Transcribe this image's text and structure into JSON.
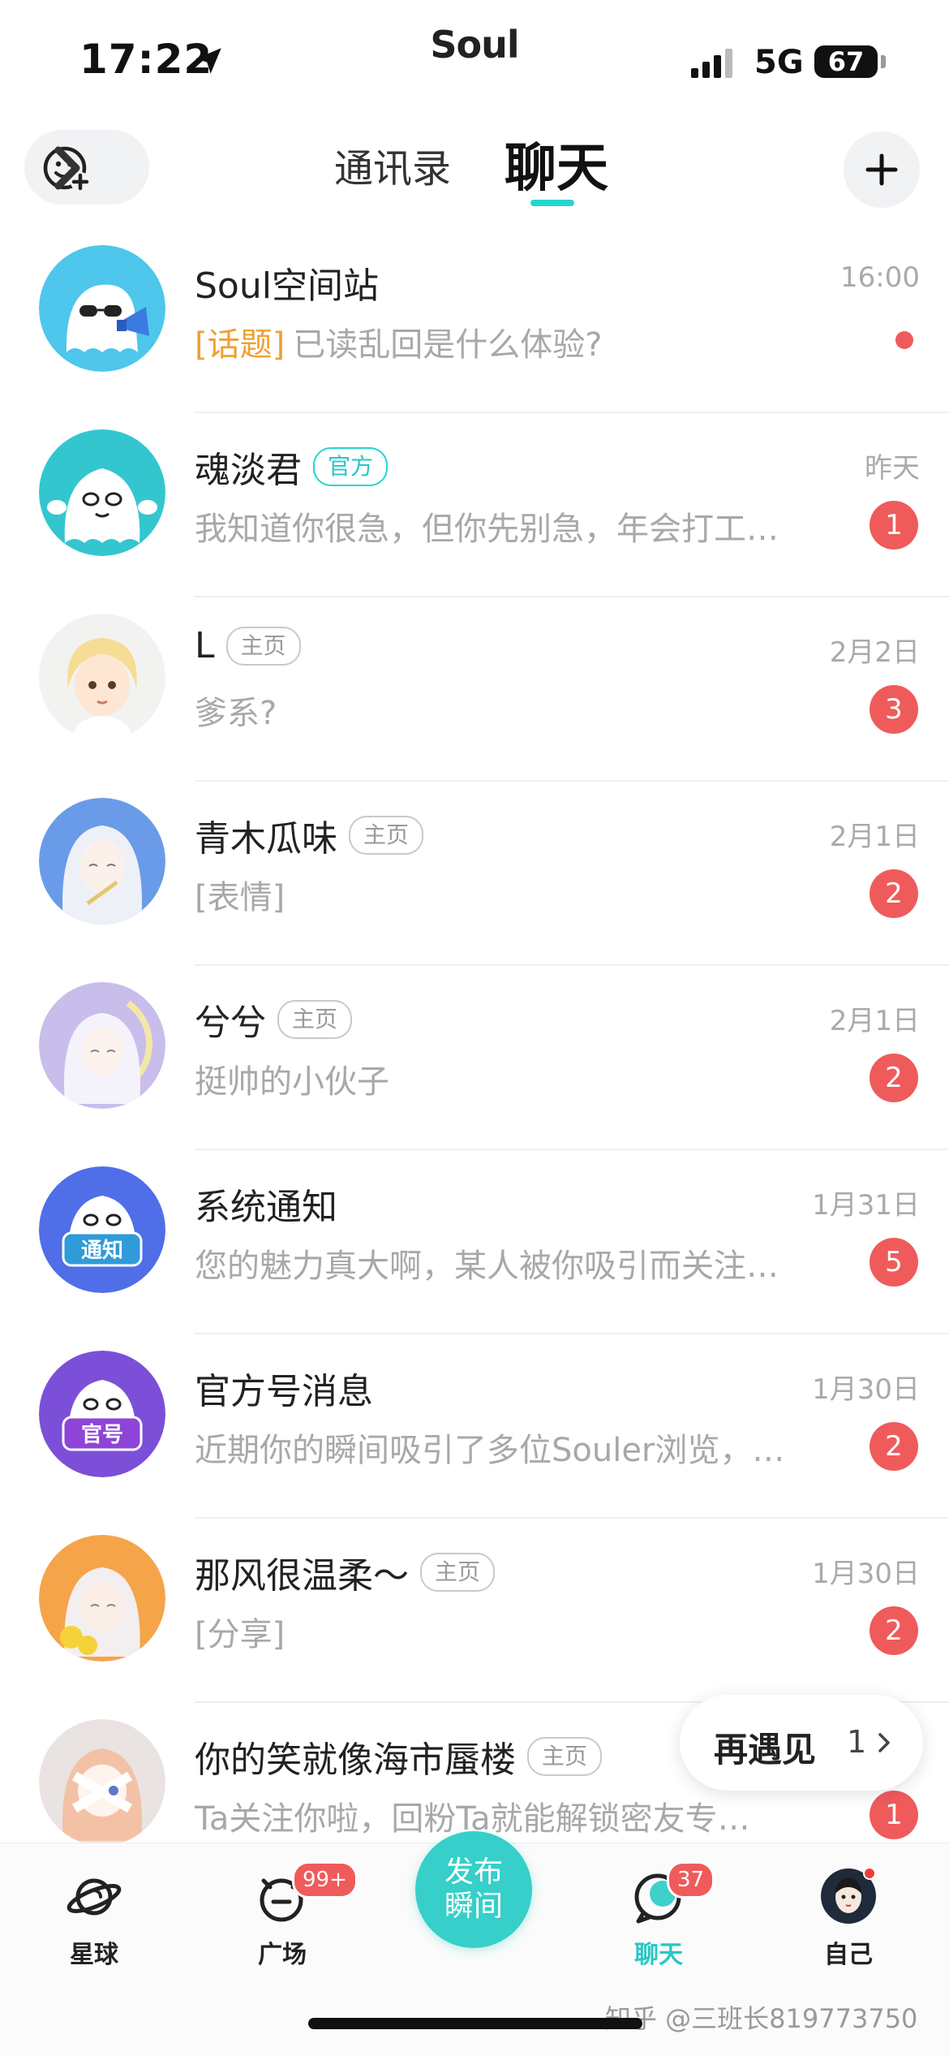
{
  "status_bar": {
    "time": "17:22",
    "carrier_logo": "Soul",
    "network": "5G",
    "battery": "67"
  },
  "header": {
    "tabs": [
      {
        "label": "通讯录",
        "active": false
      },
      {
        "label": "聊天",
        "active": true
      }
    ],
    "left_icon": "smiley-add-icon",
    "right_icon": "plus-icon"
  },
  "chats": [
    {
      "name": "Soul空间站",
      "tag": "",
      "time": "16:00",
      "topic": "[话题]",
      "preview": "已读乱回是什么体验?",
      "badge": "",
      "dot": true
    },
    {
      "name": "魂淡君",
      "tag": "官方",
      "time": "昨天",
      "topic": "",
      "preview": "我知道你很急，但你先别急，年会打工…",
      "badge": "1",
      "dot": false
    },
    {
      "name": "L",
      "tag": "主页",
      "time": "2月2日",
      "topic": "",
      "preview": "爹系?",
      "badge": "3",
      "dot": false
    },
    {
      "name": "青木瓜味",
      "tag": "主页",
      "time": "2月1日",
      "topic": "",
      "preview": "[表情]",
      "badge": "2",
      "dot": false
    },
    {
      "name": "兮兮",
      "tag": "主页",
      "time": "2月1日",
      "topic": "",
      "preview": "挺帅的小伙子",
      "badge": "2",
      "dot": false
    },
    {
      "name": "系统通知",
      "tag": "",
      "time": "1月31日",
      "topic": "",
      "preview": "您的魅力真大啊，某人被你吸引而关注…",
      "badge": "5",
      "dot": false
    },
    {
      "name": "官方号消息",
      "tag": "",
      "time": "1月30日",
      "topic": "",
      "preview": "近期你的瞬间吸引了多位Souler浏览，…",
      "badge": "2",
      "dot": false
    },
    {
      "name": "那风很温柔～",
      "tag": "主页",
      "time": "1月30日",
      "topic": "",
      "preview": "[分享]",
      "badge": "2",
      "dot": false
    },
    {
      "name": "你的笑就像海市蜃楼",
      "tag": "主页",
      "time": "",
      "topic": "",
      "preview": "Ta关注你啦，回粉Ta就能解锁密友专…",
      "badge": "1",
      "dot": false
    }
  ],
  "avatar_labels": {
    "notice": "通知",
    "official": "官号"
  },
  "meet_again": {
    "label": "再遇见",
    "count": "1"
  },
  "bottom_nav": {
    "items": [
      {
        "label": "星球",
        "badge": "",
        "active": false
      },
      {
        "label": "广场",
        "badge": "99+",
        "active": false
      },
      {
        "label": "聊天",
        "badge": "37",
        "active": true
      },
      {
        "label": "自己",
        "badge": "",
        "active": false
      }
    ],
    "publish_label": "发布瞬间"
  },
  "watermark": "知乎 @三班长819773750",
  "colors": {
    "accent": "#25d4d0",
    "badge": "#ef5b5b",
    "topic": "#f0a030"
  }
}
